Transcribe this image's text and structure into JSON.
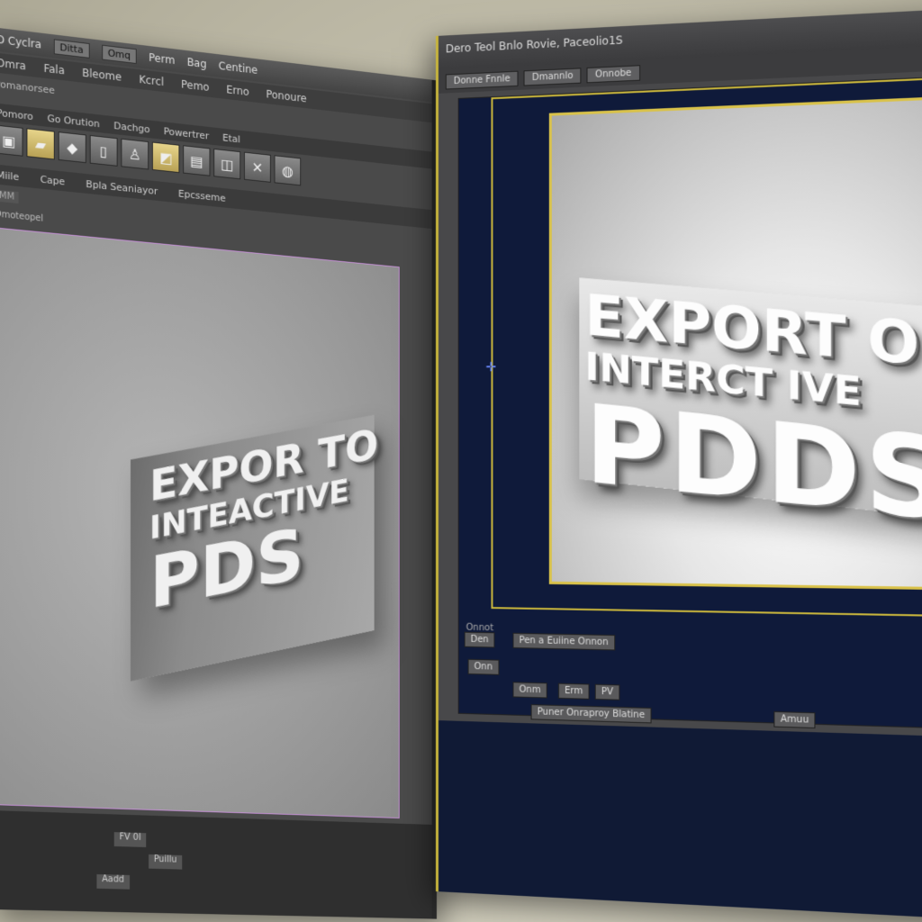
{
  "left": {
    "title": "D Cyclra",
    "title_buttons": [
      "Ditta",
      "Omq",
      "Perm",
      "Bag",
      "Centine"
    ],
    "menu": [
      "Omra",
      "Fala",
      "Bleome",
      "Kcrcl",
      "Pemo",
      "Erno",
      "Ponoure"
    ],
    "panel_label": "Pomanorsee",
    "breadcrumbs": [
      "Pomoro",
      "Go Orution",
      "Dachgo",
      "Powertrer",
      "Etal"
    ],
    "tabs": [
      "Miile",
      "Cape",
      "Bpla Seaniayor",
      "Epcsseme"
    ],
    "mode": "MM",
    "doc_label": "Dmoteopel",
    "canvas_text": {
      "line1": "EXPOR TO",
      "line2": "INTEACTIVE",
      "line3": "PDS"
    },
    "bottom_rows": [
      "FV 0I",
      "Puillu",
      "Aadd"
    ]
  },
  "right": {
    "title": "Dero Teol Bnlo Rovie, Paceolio1S",
    "toolbar": [
      "Donne Fnnle",
      "Dmannlo",
      "Onnobe"
    ],
    "canvas_text": {
      "line1": "EXPORT O",
      "line2": "INTERCT IVE",
      "line3": "PDDS"
    },
    "timeline_label": "Onnot",
    "controls": [
      "Den",
      "Pen a Euiine Onnon",
      "Onn",
      "Onm",
      "Erm",
      "PV",
      "Puner Onraproy Blatine",
      "Amuu"
    ]
  },
  "colors": {
    "accent_yellow": "#c7b43c",
    "stage_navy": "#0f1a3a",
    "selection_purple": "#c38fd3"
  }
}
